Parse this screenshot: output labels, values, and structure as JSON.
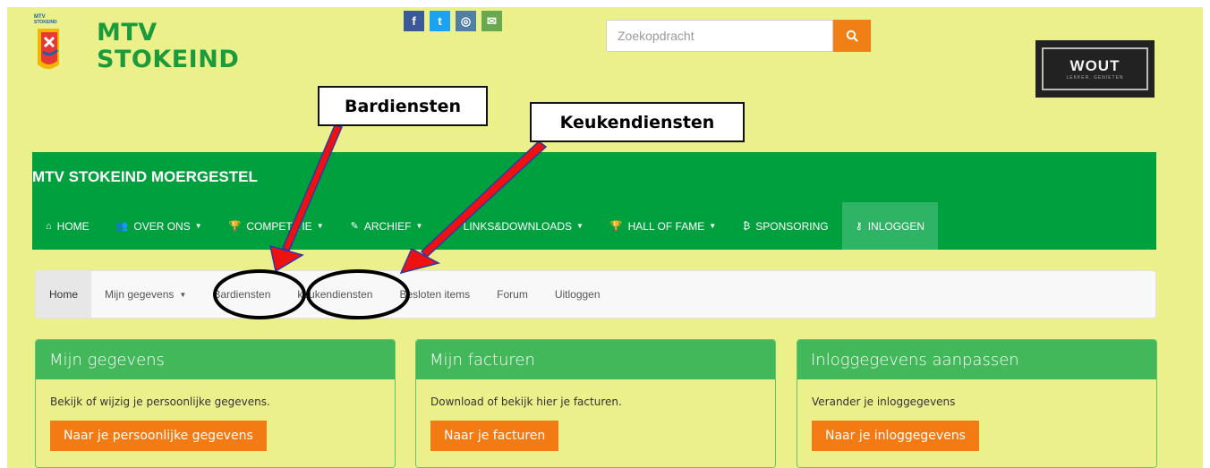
{
  "header": {
    "brand_line1": "MTV",
    "brand_line2": "STOKEIND",
    "logo_text": "MTV STOKEIND",
    "social": [
      {
        "icon": "facebook-icon",
        "glyph": "f",
        "color": "#3b5998"
      },
      {
        "icon": "twitter-icon",
        "glyph": "t",
        "color": "#1da1f2"
      },
      {
        "icon": "instagram-icon",
        "glyph": "◎",
        "color": "#517fa4"
      },
      {
        "icon": "envelope-icon",
        "glyph": "✉",
        "color": "#6aa84f"
      }
    ],
    "search_placeholder": "Zoekopdracht",
    "search_icon": "search-icon",
    "sponsor_name": "WOUT",
    "sponsor_tag": "LEKKER, GENIETEN"
  },
  "annotations": {
    "callout_1": "Bardiensten",
    "callout_2": "Keukendiensten",
    "arrow_color": "#ee1111"
  },
  "nav": {
    "title": "MTV STOKEIND MOERGESTEL",
    "items": [
      {
        "label": "HOME",
        "icon": "home-icon",
        "glyph": "⌂",
        "caret": ""
      },
      {
        "label": "OVER ONS",
        "icon": "users-icon",
        "glyph": "👥",
        "caret": "▼"
      },
      {
        "label": "COMPETITIE",
        "icon": "trophy-icon",
        "glyph": "🏆",
        "caret": "▼"
      },
      {
        "label": "ARCHIEF",
        "icon": "paperclip-icon",
        "glyph": "✎",
        "caret": "▼"
      },
      {
        "label": "LINKS&DOWNLOADS",
        "icon": "rss-icon",
        "glyph": "≋",
        "caret": "▼"
      },
      {
        "label": "HALL OF FAME",
        "icon": "trophy-icon",
        "glyph": "🏆",
        "caret": "▼"
      },
      {
        "label": "SPONSORING",
        "icon": "bitcoin-icon",
        "glyph": "₿",
        "caret": ""
      },
      {
        "label": "INLOGGEN",
        "icon": "key-icon",
        "glyph": "⚷",
        "caret": ""
      }
    ],
    "colors": {
      "bar": "#00a03e",
      "active": "#2fb466"
    }
  },
  "subnav": {
    "items": [
      {
        "label": "Home",
        "caret": ""
      },
      {
        "label": "Mijn gegevens",
        "caret": "▼"
      },
      {
        "label": "Bardiensten",
        "caret": ""
      },
      {
        "label": "keukendiensten",
        "caret": ""
      },
      {
        "label": "Besloten items",
        "caret": ""
      },
      {
        "label": "Forum",
        "caret": ""
      },
      {
        "label": "Uitloggen",
        "caret": ""
      }
    ]
  },
  "cards": [
    {
      "title": "Mijn gegevens",
      "text": "Bekijk of wijzig je persoonlijke gegevens.",
      "button": "Naar je persoonlijke gegevens"
    },
    {
      "title": "Mijn facturen",
      "text": "Download of bekijk hier je facturen.",
      "button": "Naar je facturen"
    },
    {
      "title": "Inloggegevens aanpassen",
      "text": "Verander je inloggegevens",
      "button": "Naar je inloggegevens"
    }
  ],
  "theme": {
    "page_bg": "#ecf08b",
    "brand_green": "#1b9b3a",
    "accent_orange": "#f47a14",
    "card_header": "#43b85a"
  }
}
